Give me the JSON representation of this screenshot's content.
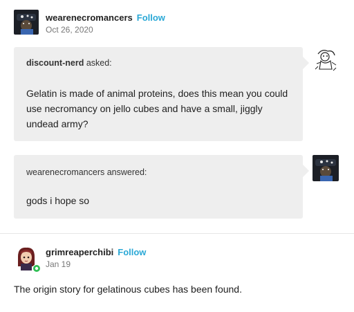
{
  "post": {
    "author": "wearenecromancers",
    "follow_label": "Follow",
    "date": "Oct 26, 2020"
  },
  "ask": {
    "asker": "discount-nerd",
    "asked_suffix": "asked:",
    "question": "Gelatin is made of animal proteins, does this mean you could use necromancy on jello cubes and have a small, jiggly undead army?"
  },
  "answer": {
    "answerer": "wearenecromancers",
    "answered_suffix": "answered:",
    "text": "gods i hope so"
  },
  "reblog": {
    "author": "grimreaperchibi",
    "follow_label": "Follow",
    "date": "Jan 19",
    "text": "The origin story for gelatinous cubes has been found."
  },
  "colors": {
    "follow": "#2aa8d6",
    "bubble": "#eeeeee",
    "online_badge": "#2fbf54"
  }
}
